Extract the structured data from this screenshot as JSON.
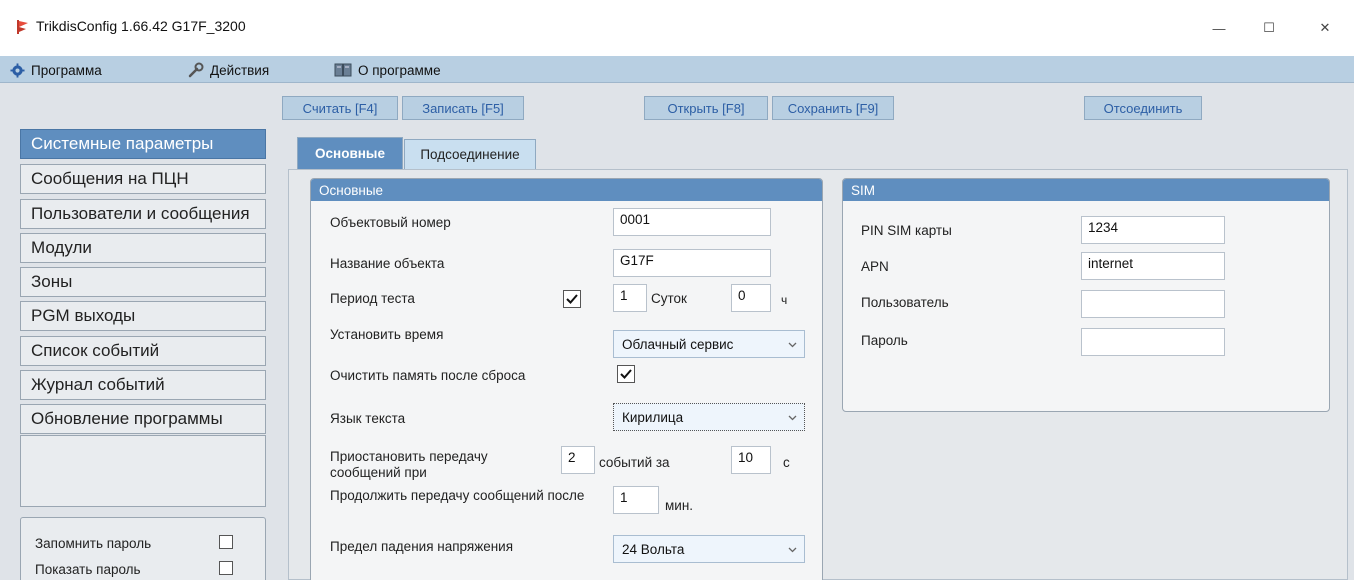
{
  "window": {
    "title": "TrikdisConfig 1.66.42   G17F_3200",
    "minimize": "—",
    "maximize": "☐",
    "close": "✕"
  },
  "menu": {
    "program": "Программа",
    "actions": "Действия",
    "about": "О программе"
  },
  "toolbar": {
    "read": "Считать [F4]",
    "write": "Записать [F5]",
    "open": "Открыть [F8]",
    "save": "Сохранить [F9]",
    "disconnect": "Отсоединить"
  },
  "sidebar": {
    "items": [
      "Системные параметры",
      "Сообщения на ПЦН",
      "Пользователи и сообщения",
      "Модули",
      "Зоны",
      "PGM выходы",
      "Список событий",
      "Журнал событий",
      "Обновление программы"
    ],
    "active_index": 0
  },
  "options": {
    "remember_password": "Запомнить пароль",
    "show_password": "Показать пароль"
  },
  "tabs": {
    "main": "Основные",
    "connection": "Подсоединение"
  },
  "main_group": {
    "title": "Основные",
    "object_number_label": "Объектовый номер",
    "object_number": "0001",
    "object_name_label": "Название объекта",
    "object_name": "G17F",
    "test_period_label": "Период теста",
    "test_period_days": "1",
    "days_unit": "Суток",
    "test_period_hours": "0",
    "hours_unit": "ч",
    "set_time_label": "Установить время",
    "set_time_value": "Облачный сервис",
    "clear_memory_label": "Очистить память после сброса",
    "text_language_label": "Язык текста",
    "text_language_value": "Кирилица",
    "suspend_label": "Приостановить передачу сообщений при",
    "suspend_events": "2",
    "events_for_label": "событий за",
    "suspend_seconds": "10",
    "seconds_unit": "с",
    "resume_label": "Продолжить передачу сообщений после",
    "resume_minutes": "1",
    "minutes_unit": "мин.",
    "voltage_label": "Предел падения напряжения",
    "voltage_value": "24 Вольта"
  },
  "sim_group": {
    "title": "SIM",
    "pin_label": "PIN SIM карты",
    "pin_value": "1234",
    "apn_label": "APN",
    "apn_value": "internet",
    "user_label": "Пользователь",
    "user_value": "",
    "password_label": "Пароль",
    "password_value": ""
  },
  "icons": {
    "app": "trikdis-flag-icon",
    "program": "gear-icon",
    "actions": "wrench-icon",
    "about": "book-icon"
  },
  "colors": {
    "accent": "#5f8ebf",
    "menubar": "#b8cfe2",
    "button_text": "#2c5ea5"
  }
}
